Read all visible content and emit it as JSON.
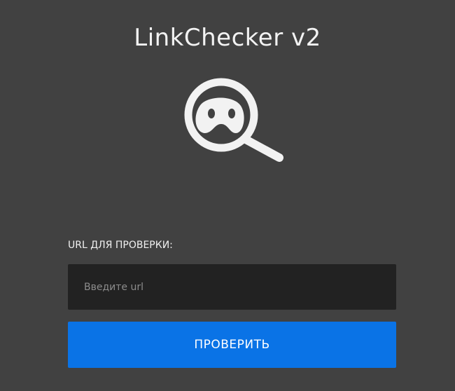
{
  "header": {
    "title": "LinkChecker v2"
  },
  "logo": {
    "icon": "magnifier-icon",
    "color": "#f2f2f2"
  },
  "form": {
    "url_label": "URL ДЛЯ ПРОВЕРКИ:",
    "url_input": {
      "placeholder": "Введите url",
      "value": ""
    },
    "submit_label": "ПРОВЕРИТЬ"
  },
  "colors": {
    "background": "#414141",
    "input_background": "#222222",
    "accent": "#0a73e6",
    "text": "#f2f2f2"
  }
}
